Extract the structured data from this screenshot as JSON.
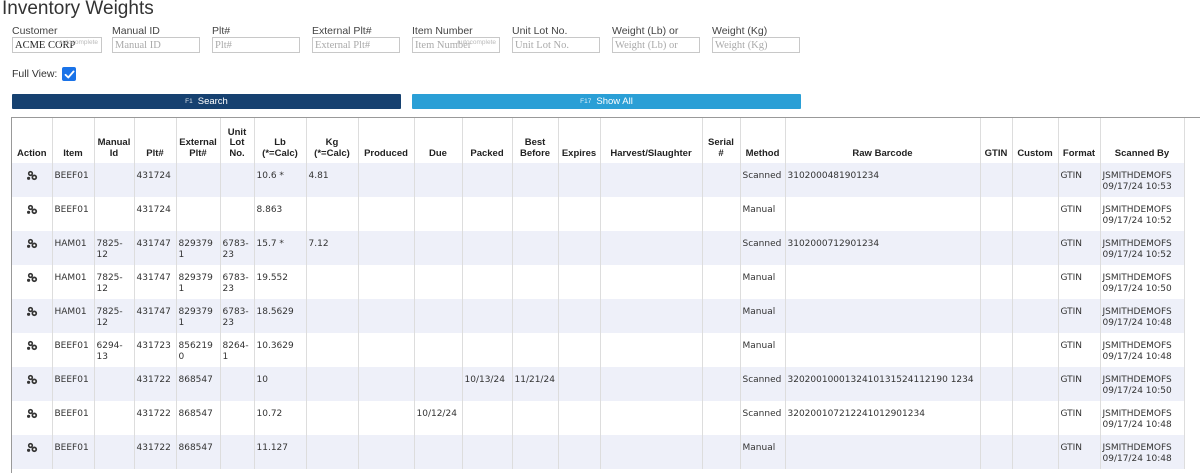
{
  "page": {
    "title": "Inventory Weights"
  },
  "filters": [
    {
      "key": "customer",
      "label": "Customer",
      "value": "ACME CORP",
      "placeholder": "",
      "autocomplete": "autocomplete",
      "width": 90
    },
    {
      "key": "manual_id",
      "label": "Manual ID",
      "value": "",
      "placeholder": "Manual ID",
      "autocomplete": "",
      "width": 88
    },
    {
      "key": "plt",
      "label": "Plt#",
      "value": "",
      "placeholder": "Plt#",
      "autocomplete": "",
      "width": 88
    },
    {
      "key": "external_plt",
      "label": "External Plt#",
      "value": "",
      "placeholder": "External Plt#",
      "autocomplete": "",
      "width": 88
    },
    {
      "key": "item_number",
      "label": "Item Number",
      "value": "",
      "placeholder": "Item Number",
      "autocomplete": "autocomplete",
      "width": 88
    },
    {
      "key": "unit_lot",
      "label": "Unit Lot No.",
      "value": "",
      "placeholder": "Unit Lot No.",
      "autocomplete": "",
      "width": 88
    },
    {
      "key": "weight_lb",
      "label": "Weight (Lb) or",
      "value": "",
      "placeholder": "Weight (Lb) or",
      "autocomplete": "",
      "width": 88
    },
    {
      "key": "weight_kg",
      "label": "Weight (Kg)",
      "value": "",
      "placeholder": "Weight (Kg)",
      "autocomplete": "",
      "width": 88
    }
  ],
  "full_view": {
    "label": "Full View:",
    "checked": true
  },
  "buttons": {
    "search": {
      "key": "F1",
      "label": "Search"
    },
    "show_all": {
      "key": "F17",
      "label": "Show All"
    }
  },
  "colors": {
    "search_btn": "#164170",
    "show_all_btn": "#2a9fd6",
    "stripe": "#eef0f9",
    "checkbox": "#1a73e8"
  },
  "table": {
    "columns": [
      {
        "key": "action",
        "label": "Action"
      },
      {
        "key": "item",
        "label": "Item"
      },
      {
        "key": "manual_id",
        "label": "Manual\nId"
      },
      {
        "key": "plt",
        "label": "Plt#"
      },
      {
        "key": "external_plt",
        "label": "External\nPlt#"
      },
      {
        "key": "unit_lot",
        "label": "Unit\nLot\nNo."
      },
      {
        "key": "lb",
        "label": "Lb\n(*=Calc)"
      },
      {
        "key": "kg",
        "label": "Kg\n(*=Calc)"
      },
      {
        "key": "produced",
        "label": "Produced"
      },
      {
        "key": "due",
        "label": "Due"
      },
      {
        "key": "packed",
        "label": "Packed"
      },
      {
        "key": "best_before",
        "label": "Best\nBefore"
      },
      {
        "key": "expires",
        "label": "Expires"
      },
      {
        "key": "harvest",
        "label": "Harvest/Slaughter"
      },
      {
        "key": "serial",
        "label": "Serial\n#"
      },
      {
        "key": "method",
        "label": "Method"
      },
      {
        "key": "raw_barcode",
        "label": "Raw Barcode"
      },
      {
        "key": "gtin",
        "label": "GTIN"
      },
      {
        "key": "custom",
        "label": "Custom"
      },
      {
        "key": "format",
        "label": "Format"
      },
      {
        "key": "scanned_by",
        "label": "Scanned By"
      }
    ],
    "rows": [
      {
        "item": "BEEF01",
        "manual_id": "",
        "plt": "431724",
        "external_plt": "",
        "unit_lot": "",
        "lb": "10.6 *",
        "kg": "4.81",
        "produced": "",
        "due": "",
        "packed": "",
        "best_before": "",
        "expires": "",
        "harvest": "",
        "serial": "",
        "method": "Scanned",
        "raw_barcode": "3102000481901234",
        "gtin": "",
        "custom": "",
        "format": "GTIN",
        "scanned_by": "JSMITHDEMOFS\n09/17/24 10:53"
      },
      {
        "item": "BEEF01",
        "manual_id": "",
        "plt": "431724",
        "external_plt": "",
        "unit_lot": "",
        "lb": "8.863",
        "kg": "",
        "produced": "",
        "due": "",
        "packed": "",
        "best_before": "",
        "expires": "",
        "harvest": "",
        "serial": "",
        "method": "Manual",
        "raw_barcode": "",
        "gtin": "",
        "custom": "",
        "format": "GTIN",
        "scanned_by": "JSMITHDEMOFS\n09/17/24 10:52"
      },
      {
        "item": "HAM01",
        "manual_id": "7825-12",
        "plt": "431747",
        "external_plt": "8293791",
        "unit_lot": "6783-23",
        "lb": "15.7 *",
        "kg": "7.12",
        "produced": "",
        "due": "",
        "packed": "",
        "best_before": "",
        "expires": "",
        "harvest": "",
        "serial": "",
        "method": "Scanned",
        "raw_barcode": "3102000712901234",
        "gtin": "",
        "custom": "",
        "format": "GTIN",
        "scanned_by": "JSMITHDEMOFS\n09/17/24 10:52"
      },
      {
        "item": "HAM01",
        "manual_id": "7825-12",
        "plt": "431747",
        "external_plt": "8293791",
        "unit_lot": "6783-23",
        "lb": "19.552",
        "kg": "",
        "produced": "",
        "due": "",
        "packed": "",
        "best_before": "",
        "expires": "",
        "harvest": "",
        "serial": "",
        "method": "Manual",
        "raw_barcode": "",
        "gtin": "",
        "custom": "",
        "format": "GTIN",
        "scanned_by": "JSMITHDEMOFS\n09/17/24 10:50"
      },
      {
        "item": "HAM01",
        "manual_id": "7825-12",
        "plt": "431747",
        "external_plt": "8293791",
        "unit_lot": "6783-23",
        "lb": "18.5629",
        "kg": "",
        "produced": "",
        "due": "",
        "packed": "",
        "best_before": "",
        "expires": "",
        "harvest": "",
        "serial": "",
        "method": "Manual",
        "raw_barcode": "",
        "gtin": "",
        "custom": "",
        "format": "GTIN",
        "scanned_by": "JSMITHDEMOFS\n09/17/24 10:48"
      },
      {
        "item": "BEEF01",
        "manual_id": "6294-13",
        "plt": "431723",
        "external_plt": "8562190",
        "unit_lot": "8264-1",
        "lb": "10.3629",
        "kg": "",
        "produced": "",
        "due": "",
        "packed": "",
        "best_before": "",
        "expires": "",
        "harvest": "",
        "serial": "",
        "method": "Manual",
        "raw_barcode": "",
        "gtin": "",
        "custom": "",
        "format": "GTIN",
        "scanned_by": "JSMITHDEMOFS\n09/17/24 10:48"
      },
      {
        "item": "BEEF01",
        "manual_id": "",
        "plt": "431722",
        "external_plt": "868547",
        "unit_lot": "",
        "lb": "10",
        "kg": "",
        "produced": "",
        "due": "",
        "packed": "10/13/24",
        "best_before": "11/21/24",
        "expires": "",
        "harvest": "",
        "serial": "",
        "method": "Scanned",
        "raw_barcode": "3202001000132410131524112190 1234",
        "gtin": "",
        "custom": "",
        "format": "GTIN",
        "scanned_by": "JSMITHDEMOFS\n09/17/24 10:50"
      },
      {
        "item": "BEEF01",
        "manual_id": "",
        "plt": "431722",
        "external_plt": "868547",
        "unit_lot": "",
        "lb": "10.72",
        "kg": "",
        "produced": "",
        "due": "10/12/24",
        "packed": "",
        "best_before": "",
        "expires": "",
        "harvest": "",
        "serial": "",
        "method": "Scanned",
        "raw_barcode": "320200107212241012901234",
        "gtin": "",
        "custom": "",
        "format": "GTIN",
        "scanned_by": "JSMITHDEMOFS\n09/17/24 10:48"
      },
      {
        "item": "BEEF01",
        "manual_id": "",
        "plt": "431722",
        "external_plt": "868547",
        "unit_lot": "",
        "lb": "11.127",
        "kg": "",
        "produced": "",
        "due": "",
        "packed": "",
        "best_before": "",
        "expires": "",
        "harvest": "",
        "serial": "",
        "method": "Manual",
        "raw_barcode": "",
        "gtin": "",
        "custom": "",
        "format": "GTIN",
        "scanned_by": "JSMITHDEMOFS\n09/17/24 10:48"
      }
    ]
  }
}
